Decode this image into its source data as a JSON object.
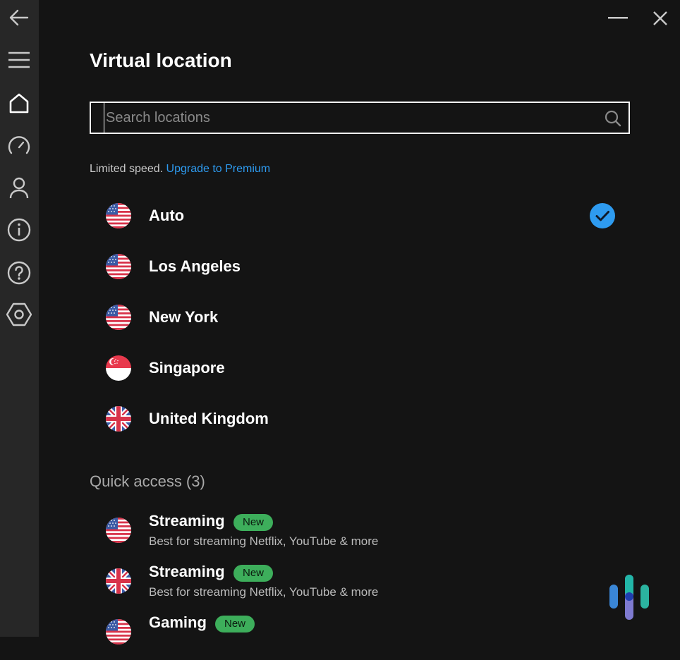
{
  "window": {
    "minimize_icon": "minimize-icon",
    "close_icon": "close-icon"
  },
  "sidebar": {
    "items": [
      {
        "icon": "back-arrow-icon"
      },
      {
        "icon": "menu-icon"
      },
      {
        "icon": "home-icon",
        "active": true
      },
      {
        "icon": "speedometer-icon"
      },
      {
        "icon": "account-icon"
      },
      {
        "icon": "info-icon"
      },
      {
        "icon": "help-icon"
      },
      {
        "icon": "settings-icon"
      }
    ]
  },
  "main": {
    "title": "Virtual location",
    "search": {
      "placeholder": "Search locations",
      "value": ""
    },
    "notice": {
      "text": "Limited speed.",
      "link": "Upgrade to Premium"
    },
    "locations": [
      {
        "name": "Auto",
        "flag": "us",
        "selected": true
      },
      {
        "name": "Los Angeles",
        "flag": "us"
      },
      {
        "name": "New York",
        "flag": "us"
      },
      {
        "name": "Singapore",
        "flag": "sg"
      },
      {
        "name": "United Kingdom",
        "flag": "uk"
      }
    ],
    "quick_access": {
      "title": "Quick access (3)",
      "items": [
        {
          "name": "Streaming",
          "badge": "New",
          "description": "Best for streaming Netflix, YouTube & more",
          "flag": "us"
        },
        {
          "name": "Streaming",
          "badge": "New",
          "description": "Best for streaming Netflix, YouTube & more",
          "flag": "uk"
        },
        {
          "name": "Gaming",
          "badge": "New",
          "description": "",
          "flag": "us"
        }
      ]
    }
  },
  "colors": {
    "accent": "#2e9bf0",
    "badge": "#3dae5b",
    "sidebar_bg": "#272727",
    "main_bg": "#141414"
  }
}
